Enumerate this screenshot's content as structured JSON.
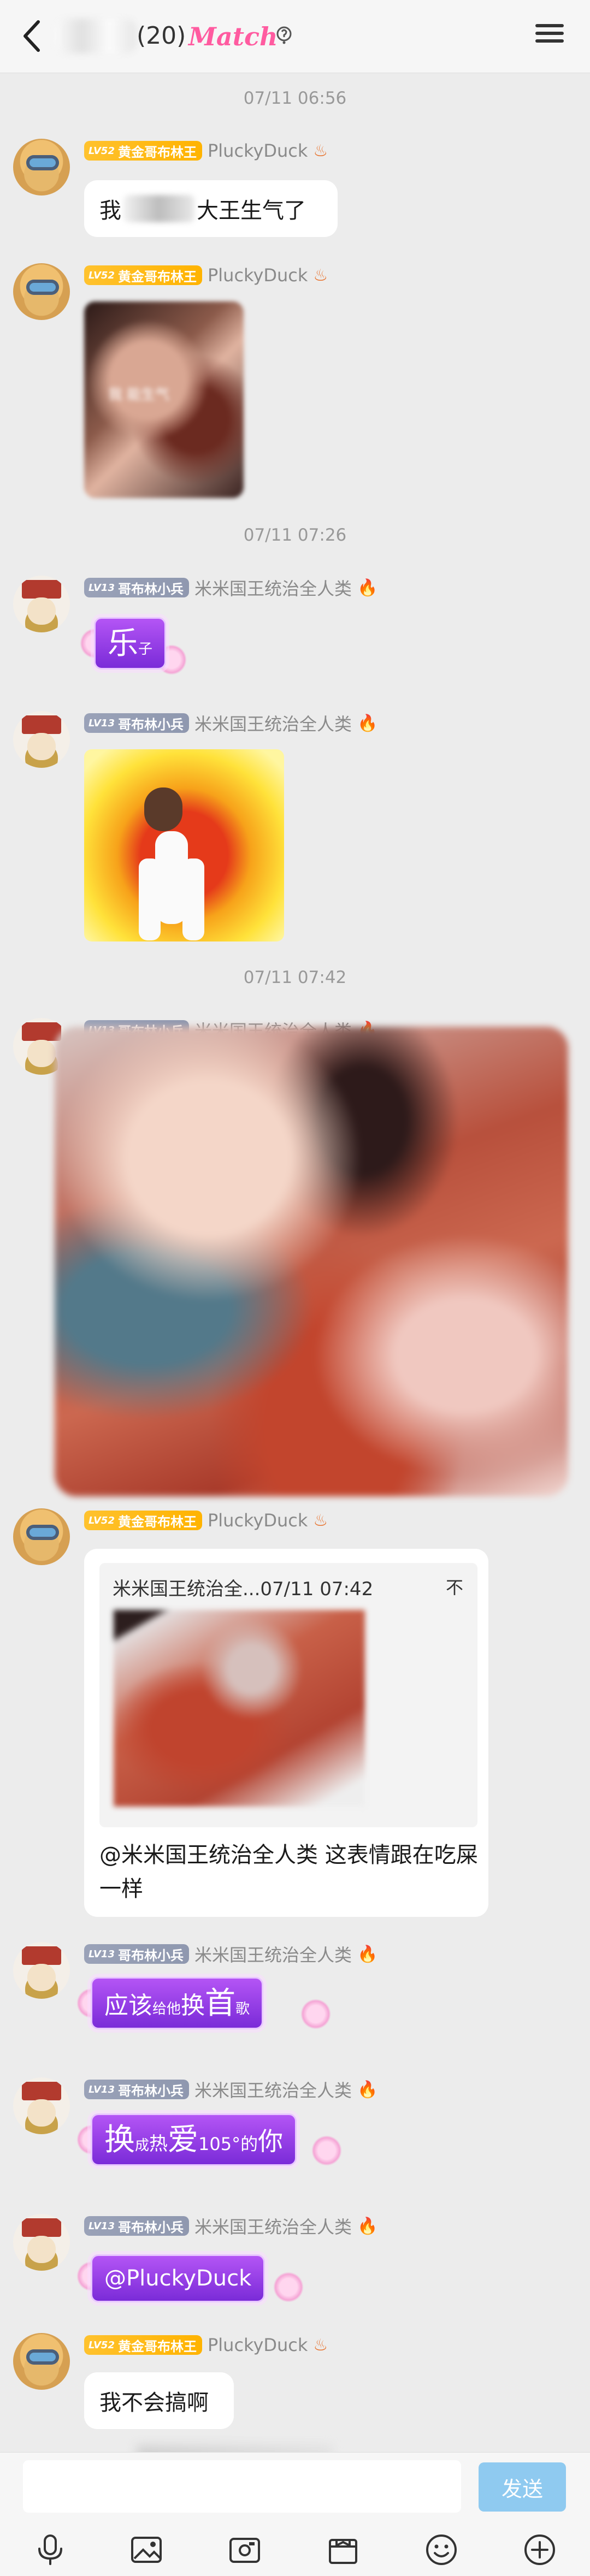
{
  "header": {
    "count": "(20)",
    "brand": "Match"
  },
  "timestamps": [
    "07/11 06:56",
    "07/11 07:26",
    "07/11 07:42"
  ],
  "users": {
    "duck": {
      "level": "LV52",
      "title": "黄金哥布林王",
      "nick": "PluckyDuck"
    },
    "guard": {
      "level": "LV13",
      "title": "哥布林小兵",
      "nick": "米米国王统治全人类"
    }
  },
  "messages": {
    "m1_prefix": "我",
    "m1_suffix": "大王生气了",
    "m2_caption": "我   能生气",
    "m3_sticker_big": "乐",
    "m3_sticker_small": "子",
    "quote_head": "米米国王统治全...07/11 07:42",
    "quote_collapse": "不",
    "quote_text": "@米米国王统治全人类 这表情跟在吃屎一样",
    "s1": [
      "应该",
      "给他",
      "换",
      "首",
      "歌"
    ],
    "s2": [
      "换",
      "成",
      "热",
      "爱",
      "105°的",
      "你"
    ],
    "s3": "@PluckyDuck",
    "last": "我不会搞啊"
  },
  "input": {
    "placeholder": "",
    "send_label": "发送"
  },
  "tools": [
    "mic-icon",
    "image-icon",
    "camera-icon",
    "gift-icon",
    "emoji-icon",
    "plus-icon"
  ]
}
